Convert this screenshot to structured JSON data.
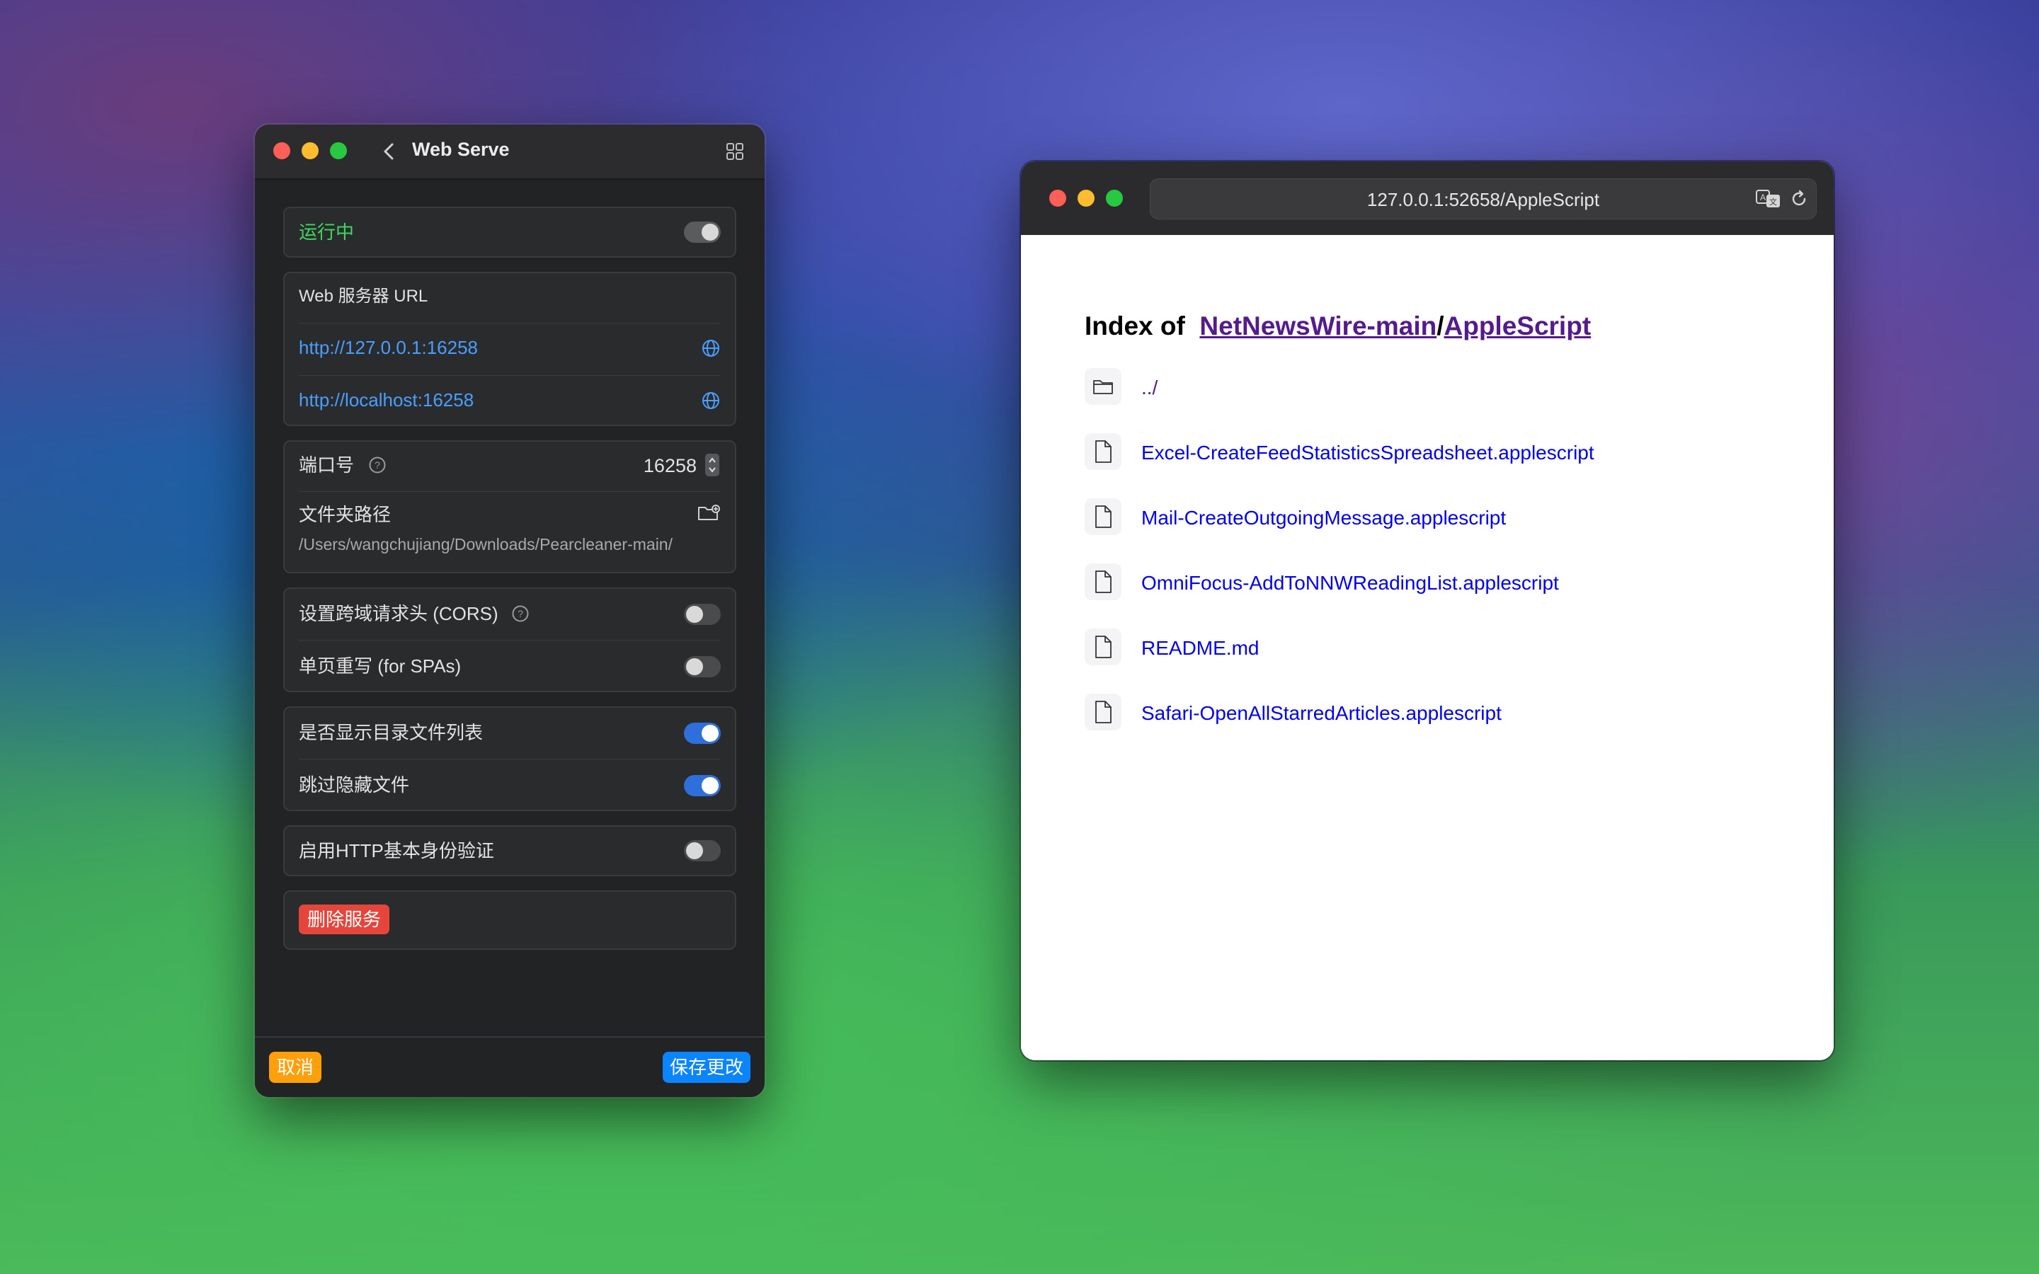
{
  "app": {
    "title": "Web Serve",
    "running_label": "运行中",
    "url_section": {
      "header": "Web 服务器 URL",
      "urls": [
        "http://127.0.0.1:16258",
        "http://localhost:16258"
      ]
    },
    "port_label": "端口号",
    "port_value": "16258",
    "folder_label": "文件夹路径",
    "folder_path": "/Users/wangchujiang/Downloads/Pearcleaner-main/",
    "cors_label": "设置跨域请求头 (CORS)",
    "spa_label": "单页重写 (for SPAs)",
    "show_dir_label": "是否显示目录文件列表",
    "skip_hidden_label": "跳过隐藏文件",
    "http_auth_label": "启用HTTP基本身份验证",
    "delete_label": "删除服务",
    "cancel_label": "取消",
    "save_label": "保存更改"
  },
  "browser": {
    "url": "127.0.0.1:52658/AppleScript",
    "heading_prefix": "Index of",
    "breadcrumb": [
      "NetNewsWire-main",
      "/",
      "AppleScript"
    ],
    "entries": [
      {
        "name": "../",
        "kind": "folder"
      },
      {
        "name": "Excel-CreateFeedStatisticsSpreadsheet.applescript",
        "kind": "file"
      },
      {
        "name": "Mail-CreateOutgoingMessage.applescript",
        "kind": "file"
      },
      {
        "name": "OmniFocus-AddToNNWReadingList.applescript",
        "kind": "file"
      },
      {
        "name": "README.md",
        "kind": "file"
      },
      {
        "name": "Safari-OpenAllStarredArticles.applescript",
        "kind": "file"
      }
    ]
  },
  "colors": {
    "running_green": "#3ed85a",
    "link_blue": "#4a9eff",
    "delete_red": "#e6453c",
    "cancel_orange": "#ff9f0a",
    "save_blue": "#0a84ff",
    "visited_purple": "#551a8b"
  }
}
